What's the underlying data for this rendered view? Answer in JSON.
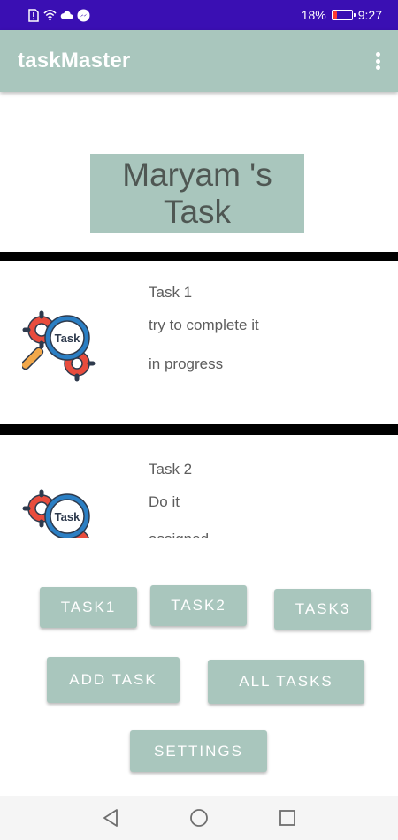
{
  "status_bar": {
    "battery_percent": "18%",
    "time": "9:27",
    "icons": [
      "sim-alert-icon",
      "wifi-icon",
      "cloud-icon",
      "messenger-icon"
    ],
    "battery_level": 0.18
  },
  "app_bar": {
    "title": "taskMaster",
    "menu_icon": "overflow-menu-icon"
  },
  "heading": {
    "line1": "Maryam 's",
    "line2": "Task"
  },
  "tasks": [
    {
      "title": "Task 1",
      "body": "try to complete it",
      "state": "in progress",
      "icon_label": "Task"
    },
    {
      "title": "Task 2",
      "body": "Do it",
      "state": "assigned",
      "icon_label": "Task"
    }
  ],
  "buttons": {
    "task1": "Task1",
    "task2": "Task2",
    "task3": "Task3",
    "add_task": "Add Task",
    "all_tasks": "All Tasks",
    "settings": "Settings"
  },
  "colors": {
    "status_bar": "#3a0fb3",
    "accent": "#a9c6bd",
    "divider": "#000000"
  },
  "nav_bar": {
    "icons": [
      "back-icon",
      "home-icon",
      "recents-icon"
    ]
  }
}
